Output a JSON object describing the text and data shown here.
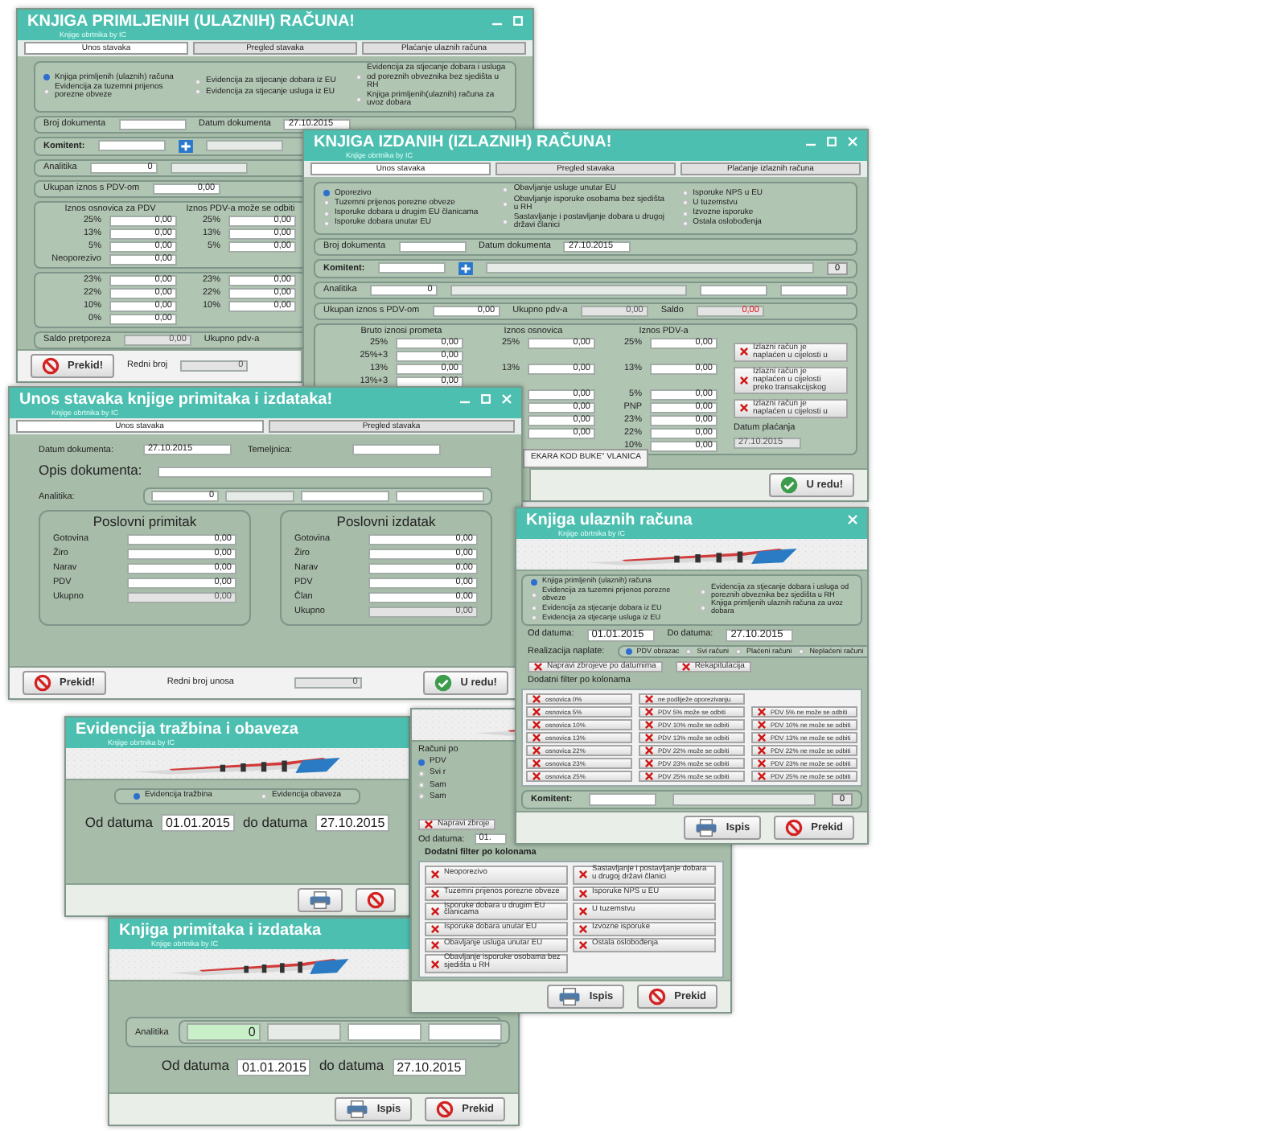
{
  "windows": [
    {
      "title": "KNJIGA PRIMLJENIH (ULAZNIH) RAČUNA!",
      "subtitle": "Knjige obrtnika by IC",
      "tabs": [
        {
          "label": "Unos stavaka",
          "selected": true
        },
        {
          "label": "Pregled stavaka",
          "selected": false
        },
        {
          "label": "Plaćanje ulaznih računa",
          "selected": false
        }
      ],
      "blocks": [
        {
          "kind": "frame",
          "rows": [
            [
              {
                "kind": "column",
                "items": [
                  {
                    "kind": "radio",
                    "label": "Knjiga primljenih (ulaznih) računa",
                    "selected": true
                  },
                  {
                    "kind": "radio",
                    "label": "Evidencija za tuzemni prijenos porezne obveze",
                    "selected": false
                  }
                ]
              },
              {
                "kind": "column",
                "items": [
                  {
                    "kind": "radio",
                    "label": "Evidencija za stjecanje dobara iz EU",
                    "selected": false
                  },
                  {
                    "kind": "radio",
                    "label": "Evidencija za stjecanje usluga iz EU",
                    "selected": false
                  }
                ]
              },
              {
                "kind": "column",
                "items": [
                  {
                    "kind": "radio",
                    "label": "Evidencija za stjecanje dobara i usluga od poreznih obveznika bez sjedišta u RH",
                    "selected": false
                  },
                  {
                    "kind": "radio",
                    "label": "Knjiga primljenih(ulaznih) računa za uvoz dobara",
                    "selected": false
                  }
                ]
              }
            ]
          ]
        },
        {
          "kind": "frame",
          "rows": [
            [
              {
                "kind": "label",
                "text": "Broj dokumenta"
              },
              {
                "kind": "text_field"
              },
              {
                "kind": "label",
                "text": "Datum dokumenta"
              },
              {
                "kind": "text_field",
                "value": "27.10.2015"
              }
            ]
          ]
        },
        {
          "kind": "frame",
          "rows": [
            [
              {
                "kind": "strong_label",
                "text": "Komitent:"
              },
              {
                "kind": "text_field"
              },
              {
                "kind": "plus"
              },
              {
                "kind": "wide_field"
              }
            ]
          ]
        },
        {
          "kind": "frame",
          "rows": [
            [
              {
                "kind": "label",
                "text": "Analitika"
              },
              {
                "kind": "field",
                "value": "0"
              },
              {
                "kind": "wide_field"
              }
            ]
          ]
        },
        {
          "kind": "frame",
          "rows": [
            [
              {
                "kind": "label",
                "text": "Ukupan iznos s PDV-om"
              },
              {
                "kind": "field",
                "value": "0,00"
              }
            ]
          ]
        },
        {
          "kind": "table",
          "headers": [
            "Iznos osnovica za PDV",
            "Iznos PDV-a može se odbiti"
          ],
          "rows": [
            {
              "rate_a": "25%",
              "amount_a": "0,00",
              "rate_b": "25%",
              "amount_b": "0,00"
            },
            {
              "rate_a": "13%",
              "amount_a": "0,00",
              "rate_b": "13%",
              "amount_b": "0,00"
            },
            {
              "rate_a": "5%",
              "amount_a": "0,00",
              "rate_b": "5%",
              "amount_b": "0,00"
            },
            {
              "rate_a": "Neoporezivo",
              "amount_a": "0,00"
            }
          ]
        },
        {
          "kind": "table",
          "rows": [
            {
              "rate_a": "23%",
              "amount_a": "0,00",
              "rate_b": "23%",
              "amount_b": "0,00"
            },
            {
              "rate_a": "22%",
              "amount_a": "0,00",
              "rate_b": "22%",
              "amount_b": "0,00"
            },
            {
              "rate_a": "10%",
              "amount_a": "0,00",
              "rate_b": "10%",
              "amount_b": "0,00"
            },
            {
              "rate_a": "0%",
              "amount_a": "0,00"
            }
          ]
        },
        {
          "kind": "frame",
          "rows": [
            [
              {
                "kind": "label",
                "text": "Saldo pretporeza"
              },
              {
                "kind": "field",
                "value": "0,00",
                "disabled": true
              },
              {
                "kind": "label",
                "text": "Ukupno pdv-a"
              }
            ]
          ]
        }
      ],
      "footer": [
        {
          "kind": "cancel_button",
          "label": "Prekid!"
        },
        {
          "kind": "label",
          "text": "Redni broj"
        },
        {
          "kind": "field",
          "value": "0",
          "disabled": true
        }
      ]
    },
    {
      "title": "KNJIGA IZDANIH (IZLAZNIH) RAČUNA!",
      "subtitle": "Knjige obrtnika by IC",
      "tabs": [
        {
          "label": "Unos stavaka",
          "selected": true
        },
        {
          "label": "Pregled stavaka",
          "selected": false
        },
        {
          "label": "Plaćanje izlaznih računa",
          "selected": false
        }
      ],
      "blocks": [
        {
          "kind": "frame",
          "rows": [
            [
              {
                "kind": "column",
                "items": [
                  {
                    "kind": "radio",
                    "label": "Oporezivo",
                    "selected": true
                  },
                  {
                    "kind": "radio",
                    "label": "Tuzemni prijenos porezne obveze",
                    "selected": false
                  },
                  {
                    "kind": "radio",
                    "label": "Isporuke dobara u drugim EU članicama",
                    "selected": false
                  },
                  {
                    "kind": "radio",
                    "label": "Isporuke dobara unutar EU",
                    "selected": false
                  }
                ]
              },
              {
                "kind": "column",
                "items": [
                  {
                    "kind": "radio",
                    "label": "Obavljanje usluge unutar EU",
                    "selected": false
                  },
                  {
                    "kind": "radio",
                    "label": "Obavljanje isporuke osobama bez sjedišta u RH",
                    "selected": false
                  },
                  {
                    "kind": "radio",
                    "label": "Sastavljanje i postavljanje dobara u drugoj državi članici",
                    "selected": false
                  }
                ]
              },
              {
                "kind": "column",
                "items": [
                  {
                    "kind": "radio",
                    "label": "Isporuke NPS u EU",
                    "selected": false
                  },
                  {
                    "kind": "radio",
                    "label": "U tuzemstvu",
                    "selected": false
                  },
                  {
                    "kind": "radio",
                    "label": "Izvozne isporuke",
                    "selected": false
                  },
                  {
                    "kind": "radio",
                    "label": "Ostala oslobođenja",
                    "selected": false
                  }
                ]
              }
            ]
          ]
        },
        {
          "kind": "frame",
          "rows": [
            [
              {
                "kind": "label",
                "text": "Broj dokumenta"
              },
              {
                "kind": "text_field"
              },
              {
                "kind": "label",
                "text": "Datum dokumenta"
              },
              {
                "kind": "text_field",
                "value": "27.10.2015"
              }
            ]
          ]
        },
        {
          "kind": "frame",
          "rows": [
            [
              {
                "kind": "strong_label",
                "text": "Komitent:"
              },
              {
                "kind": "text_field"
              },
              {
                "kind": "plus"
              },
              {
                "kind": "wide_field"
              },
              {
                "kind": "small_button",
                "label": "0"
              }
            ]
          ]
        },
        {
          "kind": "frame",
          "rows": [
            [
              {
                "kind": "label",
                "text": "Analitika"
              },
              {
                "kind": "field",
                "value": "0"
              },
              {
                "kind": "wide_field"
              },
              {
                "kind": "text_field"
              },
              {
                "kind": "text_field"
              }
            ]
          ]
        },
        {
          "kind": "frame",
          "rows": [
            [
              {
                "kind": "label",
                "text": "Ukupan iznos s PDV-om"
              },
              {
                "kind": "field",
                "value": "0,00"
              },
              {
                "kind": "label",
                "text": "Ukupno pdv-a"
              },
              {
                "kind": "field",
                "value": "0,00",
                "disabled": true
              },
              {
                "kind": "label",
                "text": "Saldo"
              },
              {
                "kind": "field",
                "value": "0,00",
                "disabled": true,
                "alert": true
              }
            ]
          ]
        },
        {
          "kind": "table",
          "headers": [
            "Bruto iznosi prometa",
            "Iznos osnovica",
            "Iznos PDV-a"
          ],
          "rows": [
            {
              "rate_a": "25%",
              "amount_a": "0,00",
              "rate_b": "25%",
              "amount_b": "0,00",
              "rate_c": "25%",
              "amount_c": "0,00"
            },
            {
              "rate_a": "25%+3",
              "amount_a": "0,00"
            },
            {
              "rate_a": "13%",
              "amount_a": "0,00",
              "rate_b": "13%",
              "amount_b": "0,00",
              "rate_c": "13%",
              "amount_c": "0,00"
            },
            {
              "rate_a": "13%+3",
              "amount_a": "0,00"
            },
            {
              "amount_b": "0,00",
              "rate_c": "5%",
              "amount_c": "0,00"
            },
            {
              "amount_b": "0,00",
              "rate_c": "PNP",
              "amount_c": "0,00"
            },
            {
              "amount_b": "0,00",
              "rate_c": "23%",
              "amount_c": "0,00"
            },
            {
              "amount_b": "0,00",
              "rate_c": "22%",
              "amount_c": "0,00"
            },
            {
              "rate_c": "10%",
              "amount_c": "0,00"
            }
          ],
          "side": [
            {
              "kind": "toggle",
              "label": "Izlazni račun je naplaćen u cijelosti u",
              "checked": false
            },
            {
              "kind": "toggle",
              "label": "Izlazni račun je naplaćen u cijelosti preko transakcijskog",
              "checked": false
            },
            {
              "kind": "toggle",
              "label": "Izlazni račun je naplaćen u cijelosti u",
              "checked": false
            },
            {
              "kind": "label",
              "text": "Datum plaćanja"
            },
            {
              "kind": "text_field",
              "value": "27.10.2015",
              "disabled": true
            }
          ]
        }
      ],
      "tooltip": "EKARA KOD BUKE\" VLANICA",
      "footer": [
        {
          "kind": "ok_button",
          "label": "U redu!"
        }
      ]
    },
    {
      "title": "Unos stavaka knjige primitaka i izdataka!",
      "subtitle": "Knjige obrtnika by IC",
      "tabs": [
        {
          "label": "Unos stavaka",
          "selected": true
        },
        {
          "label": "Pregled stavaka",
          "selected": false
        }
      ],
      "blocks": [
        {
          "kind": "plain",
          "rows": [
            [
              {
                "kind": "label",
                "text": "Datum dokumenta:"
              },
              {
                "kind": "text_field",
                "value": "27.10.2015"
              },
              {
                "kind": "label",
                "text": "Temeljnica:"
              },
              {
                "kind": "text_field"
              }
            ]
          ]
        },
        {
          "kind": "plain",
          "rows": [
            [
              {
                "kind": "caption",
                "text": "Opis dokumenta:"
              },
              {
                "kind": "long_field"
              }
            ]
          ]
        },
        {
          "kind": "plain",
          "rows": [
            [
              {
                "kind": "label",
                "text": "Analitika:"
              },
              {
                "kind": "inline_group",
                "items": [
                  {
                    "kind": "field",
                    "value": "0"
                  },
                  {
                    "kind": "wide_field"
                  },
                  {
                    "kind": "text_field"
                  },
                  {
                    "kind": "text_field"
                  }
                ]
              }
            ]
          ]
        },
        {
          "kind": "plain",
          "rows": [
            [
              {
                "kind": "panel",
                "heading": "Poslovni primitak",
                "rows": [
                  [
                    {
                      "kind": "label",
                      "text": "Gotovina"
                    },
                    {
                      "kind": "field",
                      "value": "0,00"
                    }
                  ],
                  [
                    {
                      "kind": "label",
                      "text": "Žiro"
                    },
                    {
                      "kind": "field",
                      "value": "0,00"
                    }
                  ],
                  [
                    {
                      "kind": "label",
                      "text": "Narav"
                    },
                    {
                      "kind": "field",
                      "value": "0,00"
                    }
                  ],
                  [
                    {
                      "kind": "label",
                      "text": "PDV"
                    },
                    {
                      "kind": "field",
                      "value": "0,00"
                    }
                  ],
                  [
                    {
                      "kind": "label",
                      "text": "Ukupno"
                    },
                    {
                      "kind": "field",
                      "value": "0,00",
                      "disabled": true
                    }
                  ]
                ]
              },
              {
                "kind": "panel",
                "heading": "Poslovni izdatak",
                "rows": [
                  [
                    {
                      "kind": "label",
                      "text": "Gotovina"
                    },
                    {
                      "kind": "field",
                      "value": "0,00"
                    }
                  ],
                  [
                    {
                      "kind": "label",
                      "text": "Žiro"
                    },
                    {
                      "kind": "field",
                      "value": "0,00"
                    }
                  ],
                  [
                    {
                      "kind": "label",
                      "text": "Narav"
                    },
                    {
                      "kind": "field",
                      "value": "0,00"
                    }
                  ],
                  [
                    {
                      "kind": "label",
                      "text": "PDV"
                    },
                    {
                      "kind": "field",
                      "value": "0,00"
                    }
                  ],
                  [
                    {
                      "kind": "label",
                      "text": "Član"
                    },
                    {
                      "kind": "field",
                      "value": "0,00"
                    }
                  ],
                  [
                    {
                      "kind": "label",
                      "text": "Ukupno"
                    },
                    {
                      "kind": "field",
                      "value": "0,00",
                      "disabled": true
                    }
                  ]
                ]
              }
            ]
          ]
        }
      ],
      "footer": [
        {
          "kind": "cancel_button",
          "label": "Prekid!"
        },
        {
          "kind": "label",
          "text": "Redni broj unosa"
        },
        {
          "kind": "field",
          "value": "0",
          "disabled": true
        },
        {
          "kind": "ok_button",
          "label": "U redu!"
        }
      ]
    },
    {
      "title": "Knjiga ulaznih računa",
      "subtitle": "Knjige obrtnika by IC",
      "banner": true,
      "blocks": [
        {
          "kind": "frame",
          "rows": [
            [
              {
                "kind": "column",
                "items": [
                  {
                    "kind": "radio",
                    "label": "Knjiga primljenih (ulaznih) računa",
                    "selected": true
                  },
                  {
                    "kind": "radio",
                    "label": "Evidencija za tuzemni prijenos porezne obveze",
                    "selected": false
                  },
                  {
                    "kind": "radio",
                    "label": "Evidencija za stjecanje dobara iz EU",
                    "selected": false
                  },
                  {
                    "kind": "radio",
                    "label": "Evidencija za stjecanje usluga iz EU",
                    "selected": false
                  }
                ]
              },
              {
                "kind": "column",
                "items": [
                  {
                    "kind": "radio",
                    "label": "Evidencija za stjecanje dobara i usluga od poreznih obveznika bez sjedišta u RH",
                    "selected": false
                  },
                  {
                    "kind": "radio",
                    "label": "Knjiga primljenih ulaznih računa za uvoz dobara",
                    "selected": false
                  }
                ]
              }
            ]
          ]
        },
        {
          "kind": "plain",
          "rows": [
            [
              {
                "kind": "label",
                "text": "Od datuma:"
              },
              {
                "kind": "text_field",
                "value": "01.01.2015"
              },
              {
                "kind": "label",
                "text": "Do datuma:"
              },
              {
                "kind": "text_field",
                "value": "27.10.2015"
              }
            ]
          ]
        },
        {
          "kind": "plain",
          "rows": [
            [
              {
                "kind": "label",
                "text": "Realizacija naplate:"
              },
              {
                "kind": "inline_group",
                "items": [
                  {
                    "kind": "radio",
                    "label": "PDV obrazac",
                    "selected": true
                  },
                  {
                    "kind": "radio",
                    "label": "Svi računi",
                    "selected": false
                  },
                  {
                    "kind": "radio",
                    "label": "Plaćeni računi",
                    "selected": false
                  },
                  {
                    "kind": "radio",
                    "label": "Neplaćeni računi",
                    "selected": false
                  }
                ]
              }
            ]
          ]
        },
        {
          "kind": "plain",
          "rows": [
            [
              {
                "kind": "toggle",
                "label": "Napravi zbrojeve po datumima",
                "checked": false
              },
              {
                "kind": "toggle",
                "label": "Rekapitulacija",
                "checked": false
              }
            ]
          ]
        },
        {
          "kind": "plain",
          "rows": [
            [
              {
                "kind": "label",
                "text": "Dodatni filter po kolonama"
              }
            ]
          ]
        },
        {
          "kind": "box",
          "rows": [
            [
              {
                "kind": "toggle",
                "label": "osnovica 0%",
                "checked": false
              },
              {
                "kind": "toggle",
                "label": "ne podliježe oporezivanju",
                "checked": false
              }
            ],
            [
              {
                "kind": "toggle",
                "label": "osnovica 5%",
                "checked": false
              },
              {
                "kind": "toggle",
                "label": "PDV 5% može se odbiti",
                "checked": false
              },
              {
                "kind": "toggle",
                "label": "PDV 5% ne može se odbiti",
                "checked": false
              }
            ],
            [
              {
                "kind": "toggle",
                "label": "osnovica 10%",
                "checked": false
              },
              {
                "kind": "toggle",
                "label": "PDV 10% može se odbiti",
                "checked": false
              },
              {
                "kind": "toggle",
                "label": "PDV 10% ne može se odbiti",
                "checked": false
              }
            ],
            [
              {
                "kind": "toggle",
                "label": "osnovica 13%",
                "checked": false
              },
              {
                "kind": "toggle",
                "label": "PDV 13% može se odbiti",
                "checked": false
              },
              {
                "kind": "toggle",
                "label": "PDV 13% ne može se odbiti",
                "checked": false
              }
            ],
            [
              {
                "kind": "toggle",
                "label": "osnovica 22%",
                "checked": false
              },
              {
                "kind": "toggle",
                "label": "PDV 22% može se odbiti",
                "checked": false
              },
              {
                "kind": "toggle",
                "label": "PDV 22% ne može se odbiti",
                "checked": false
              }
            ],
            [
              {
                "kind": "toggle",
                "label": "osnovica 23%",
                "checked": false
              },
              {
                "kind": "toggle",
                "label": "PDV 23% može se odbiti",
                "checked": false
              },
              {
                "kind": "toggle",
                "label": "PDV 23% ne može se odbiti",
                "checked": false
              }
            ],
            [
              {
                "kind": "toggle",
                "label": "osnovica 25%",
                "checked": false
              },
              {
                "kind": "toggle",
                "label": "PDV 25% može se odbiti",
                "checked": false
              },
              {
                "kind": "toggle",
                "label": "PDV 25% ne može se odbiti",
                "checked": false
              }
            ]
          ]
        },
        {
          "kind": "frame",
          "rows": [
            [
              {
                "kind": "strong_label",
                "text": "Komitent:"
              },
              {
                "kind": "text_field"
              },
              {
                "kind": "wide_field"
              },
              {
                "kind": "small_button",
                "label": "0"
              }
            ]
          ]
        }
      ],
      "footer": [
        {
          "kind": "print_button",
          "label": "Ispis"
        },
        {
          "kind": "cancel_button",
          "label": "Prekid"
        }
      ]
    },
    {
      "title": "Evidencija tražbina i obaveza",
      "subtitle": "Knjige obrtnika by IC",
      "banner": true,
      "blocks": [
        {
          "kind": "frame",
          "rows": [
            [
              {
                "kind": "radio",
                "label": "Evidencija tražbina",
                "selected": true
              },
              {
                "kind": "radio",
                "label": "Evidencija obaveza",
                "selected": false
              }
            ]
          ]
        },
        {
          "kind": "plain",
          "rows": [
            [
              {
                "kind": "caption",
                "text": "Od datuma"
              },
              {
                "kind": "text_field",
                "value": "01.01.2015"
              },
              {
                "kind": "caption",
                "text": "do datuma"
              },
              {
                "kind": "text_field",
                "value": "27.10.2015"
              }
            ]
          ]
        }
      ],
      "footer": [
        {
          "kind": "print_button"
        },
        {
          "kind": "cancel_button"
        }
      ]
    },
    {
      "banner": true,
      "blocks": [
        {
          "kind": "strip",
          "rows": [
            [
              {
                "kind": "label",
                "text": "Računi po"
              }
            ],
            [
              {
                "kind": "radio",
                "label": "PDV",
                "selected": true
              }
            ],
            [
              {
                "kind": "radio",
                "label": "Svi r",
                "selected": false
              }
            ],
            [
              {
                "kind": "radio",
                "label": "Sam",
                "selected": false
              }
            ],
            [
              {
                "kind": "radio",
                "label": "Sam",
                "selected": false
              }
            ],
            [
              {
                "kind": "toggle",
                "label": "Napravi zbroje",
                "checked": false
              }
            ],
            [
              {
                "kind": "label",
                "text": "Od datuma:"
              },
              {
                "kind": "text_field",
                "value": "01."
              }
            ]
          ]
        },
        {
          "kind": "plain",
          "rows": [
            [
              {
                "kind": "strong_label",
                "text": "Dodatni filter po kolonama"
              }
            ]
          ]
        },
        {
          "kind": "box",
          "rows": [
            [
              {
                "kind": "toggle",
                "label": "Neoporezivo",
                "checked": false
              },
              {
                "kind": "toggle",
                "label": "Sastavljanje i postavljanje dobara u drugoj državi članici",
                "checked": false
              }
            ],
            [
              {
                "kind": "toggle",
                "label": "Tuzemni prijenos porezne obveze",
                "checked": false
              },
              {
                "kind": "toggle",
                "label": "Isporuke NPS u EU",
                "checked": false
              }
            ],
            [
              {
                "kind": "toggle",
                "label": "Isporuke dobara u drugim EU članicama",
                "checked": false
              },
              {
                "kind": "toggle",
                "label": "U tuzemstvu",
                "checked": false
              }
            ],
            [
              {
                "kind": "toggle",
                "label": "Isporuke dobara unutar EU",
                "checked": false
              },
              {
                "kind": "toggle",
                "label": "Izvozne isporuke",
                "checked": false
              }
            ],
            [
              {
                "kind": "toggle",
                "label": "Obavljanje usluga unutar EU",
                "checked": false
              },
              {
                "kind": "toggle",
                "label": "Ostala oslobođenja",
                "checked": false
              }
            ],
            [
              {
                "kind": "toggle",
                "label": "Obavljanje isporuke osobama bez sjedišta u RH",
                "checked": false
              }
            ]
          ]
        }
      ],
      "footer": [
        {
          "kind": "print_button",
          "label": "Ispis"
        },
        {
          "kind": "cancel_button",
          "label": "Prekid"
        }
      ]
    },
    {
      "title": "Knjiga primitaka i izdataka",
      "subtitle": "Knjige obrtnika by IC",
      "banner": true,
      "blocks": [
        {
          "kind": "frame",
          "rows": [
            [
              {
                "kind": "label",
                "text": "Analitika"
              },
              {
                "kind": "inline_group",
                "items": [
                  {
                    "kind": "field",
                    "value": "0",
                    "color": "#c8efc8"
                  },
                  {
                    "kind": "wide_field"
                  },
                  {
                    "kind": "text_field"
                  },
                  {
                    "kind": "text_field"
                  }
                ]
              }
            ]
          ]
        },
        {
          "kind": "plain",
          "rows": [
            [
              {
                "kind": "caption",
                "text": "Od datuma"
              },
              {
                "kind": "text_field",
                "value": "01.01.2015"
              },
              {
                "kind": "caption",
                "text": "do datuma"
              },
              {
                "kind": "text_field",
                "value": "27.10.2015"
              }
            ]
          ]
        }
      ],
      "footer": [
        {
          "kind": "print_button",
          "label": "Ispis"
        },
        {
          "kind": "cancel_button",
          "label": "Prekid"
        }
      ]
    }
  ]
}
